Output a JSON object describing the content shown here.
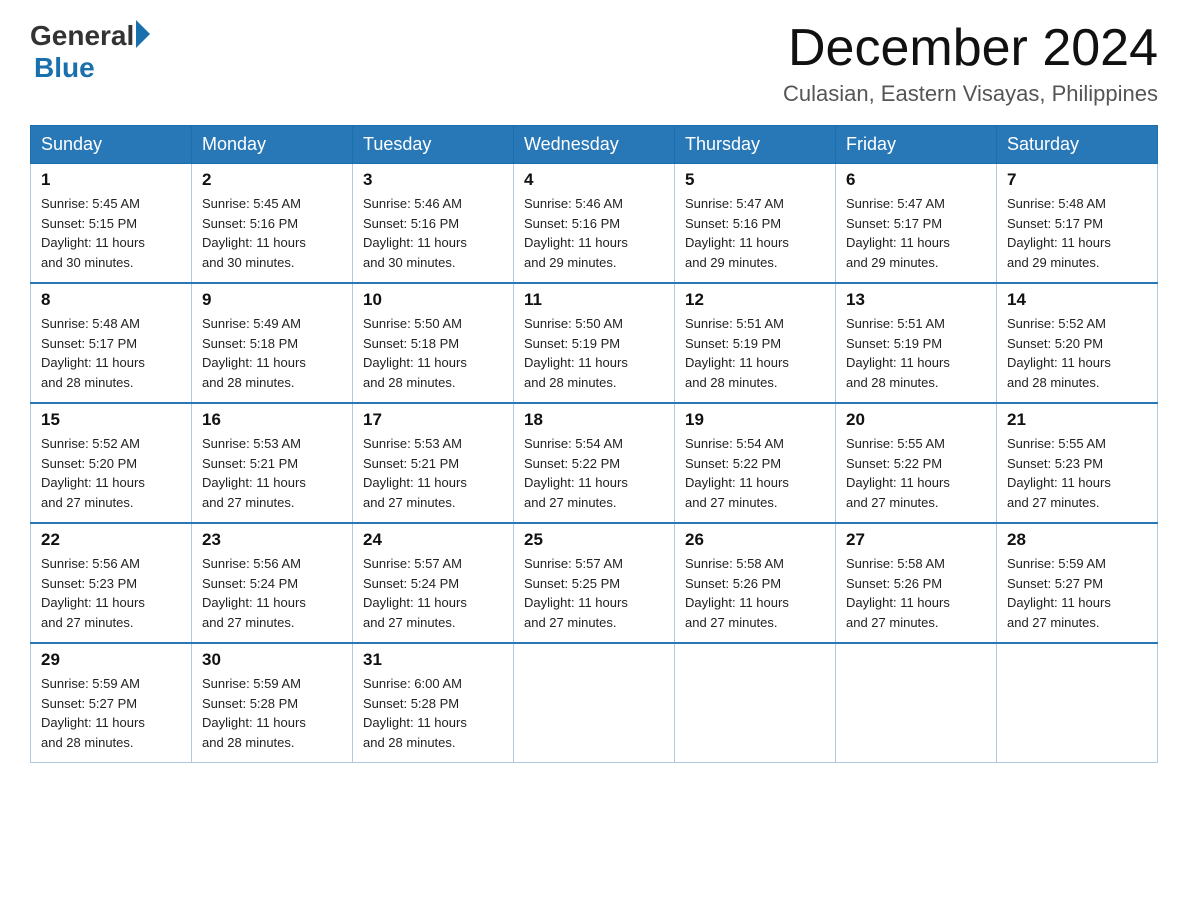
{
  "header": {
    "logo_general": "General",
    "logo_blue": "Blue",
    "month_title": "December 2024",
    "location": "Culasian, Eastern Visayas, Philippines"
  },
  "weekdays": [
    "Sunday",
    "Monday",
    "Tuesday",
    "Wednesday",
    "Thursday",
    "Friday",
    "Saturday"
  ],
  "weeks": [
    [
      {
        "day": "1",
        "sunrise": "5:45 AM",
        "sunset": "5:15 PM",
        "daylight": "11 hours and 30 minutes."
      },
      {
        "day": "2",
        "sunrise": "5:45 AM",
        "sunset": "5:16 PM",
        "daylight": "11 hours and 30 minutes."
      },
      {
        "day": "3",
        "sunrise": "5:46 AM",
        "sunset": "5:16 PM",
        "daylight": "11 hours and 30 minutes."
      },
      {
        "day": "4",
        "sunrise": "5:46 AM",
        "sunset": "5:16 PM",
        "daylight": "11 hours and 29 minutes."
      },
      {
        "day": "5",
        "sunrise": "5:47 AM",
        "sunset": "5:16 PM",
        "daylight": "11 hours and 29 minutes."
      },
      {
        "day": "6",
        "sunrise": "5:47 AM",
        "sunset": "5:17 PM",
        "daylight": "11 hours and 29 minutes."
      },
      {
        "day": "7",
        "sunrise": "5:48 AM",
        "sunset": "5:17 PM",
        "daylight": "11 hours and 29 minutes."
      }
    ],
    [
      {
        "day": "8",
        "sunrise": "5:48 AM",
        "sunset": "5:17 PM",
        "daylight": "11 hours and 28 minutes."
      },
      {
        "day": "9",
        "sunrise": "5:49 AM",
        "sunset": "5:18 PM",
        "daylight": "11 hours and 28 minutes."
      },
      {
        "day": "10",
        "sunrise": "5:50 AM",
        "sunset": "5:18 PM",
        "daylight": "11 hours and 28 minutes."
      },
      {
        "day": "11",
        "sunrise": "5:50 AM",
        "sunset": "5:19 PM",
        "daylight": "11 hours and 28 minutes."
      },
      {
        "day": "12",
        "sunrise": "5:51 AM",
        "sunset": "5:19 PM",
        "daylight": "11 hours and 28 minutes."
      },
      {
        "day": "13",
        "sunrise": "5:51 AM",
        "sunset": "5:19 PM",
        "daylight": "11 hours and 28 minutes."
      },
      {
        "day": "14",
        "sunrise": "5:52 AM",
        "sunset": "5:20 PM",
        "daylight": "11 hours and 28 minutes."
      }
    ],
    [
      {
        "day": "15",
        "sunrise": "5:52 AM",
        "sunset": "5:20 PM",
        "daylight": "11 hours and 27 minutes."
      },
      {
        "day": "16",
        "sunrise": "5:53 AM",
        "sunset": "5:21 PM",
        "daylight": "11 hours and 27 minutes."
      },
      {
        "day": "17",
        "sunrise": "5:53 AM",
        "sunset": "5:21 PM",
        "daylight": "11 hours and 27 minutes."
      },
      {
        "day": "18",
        "sunrise": "5:54 AM",
        "sunset": "5:22 PM",
        "daylight": "11 hours and 27 minutes."
      },
      {
        "day": "19",
        "sunrise": "5:54 AM",
        "sunset": "5:22 PM",
        "daylight": "11 hours and 27 minutes."
      },
      {
        "day": "20",
        "sunrise": "5:55 AM",
        "sunset": "5:22 PM",
        "daylight": "11 hours and 27 minutes."
      },
      {
        "day": "21",
        "sunrise": "5:55 AM",
        "sunset": "5:23 PM",
        "daylight": "11 hours and 27 minutes."
      }
    ],
    [
      {
        "day": "22",
        "sunrise": "5:56 AM",
        "sunset": "5:23 PM",
        "daylight": "11 hours and 27 minutes."
      },
      {
        "day": "23",
        "sunrise": "5:56 AM",
        "sunset": "5:24 PM",
        "daylight": "11 hours and 27 minutes."
      },
      {
        "day": "24",
        "sunrise": "5:57 AM",
        "sunset": "5:24 PM",
        "daylight": "11 hours and 27 minutes."
      },
      {
        "day": "25",
        "sunrise": "5:57 AM",
        "sunset": "5:25 PM",
        "daylight": "11 hours and 27 minutes."
      },
      {
        "day": "26",
        "sunrise": "5:58 AM",
        "sunset": "5:26 PM",
        "daylight": "11 hours and 27 minutes."
      },
      {
        "day": "27",
        "sunrise": "5:58 AM",
        "sunset": "5:26 PM",
        "daylight": "11 hours and 27 minutes."
      },
      {
        "day": "28",
        "sunrise": "5:59 AM",
        "sunset": "5:27 PM",
        "daylight": "11 hours and 27 minutes."
      }
    ],
    [
      {
        "day": "29",
        "sunrise": "5:59 AM",
        "sunset": "5:27 PM",
        "daylight": "11 hours and 28 minutes."
      },
      {
        "day": "30",
        "sunrise": "5:59 AM",
        "sunset": "5:28 PM",
        "daylight": "11 hours and 28 minutes."
      },
      {
        "day": "31",
        "sunrise": "6:00 AM",
        "sunset": "5:28 PM",
        "daylight": "11 hours and 28 minutes."
      },
      null,
      null,
      null,
      null
    ]
  ],
  "labels": {
    "sunrise": "Sunrise:",
    "sunset": "Sunset:",
    "daylight": "Daylight:"
  }
}
